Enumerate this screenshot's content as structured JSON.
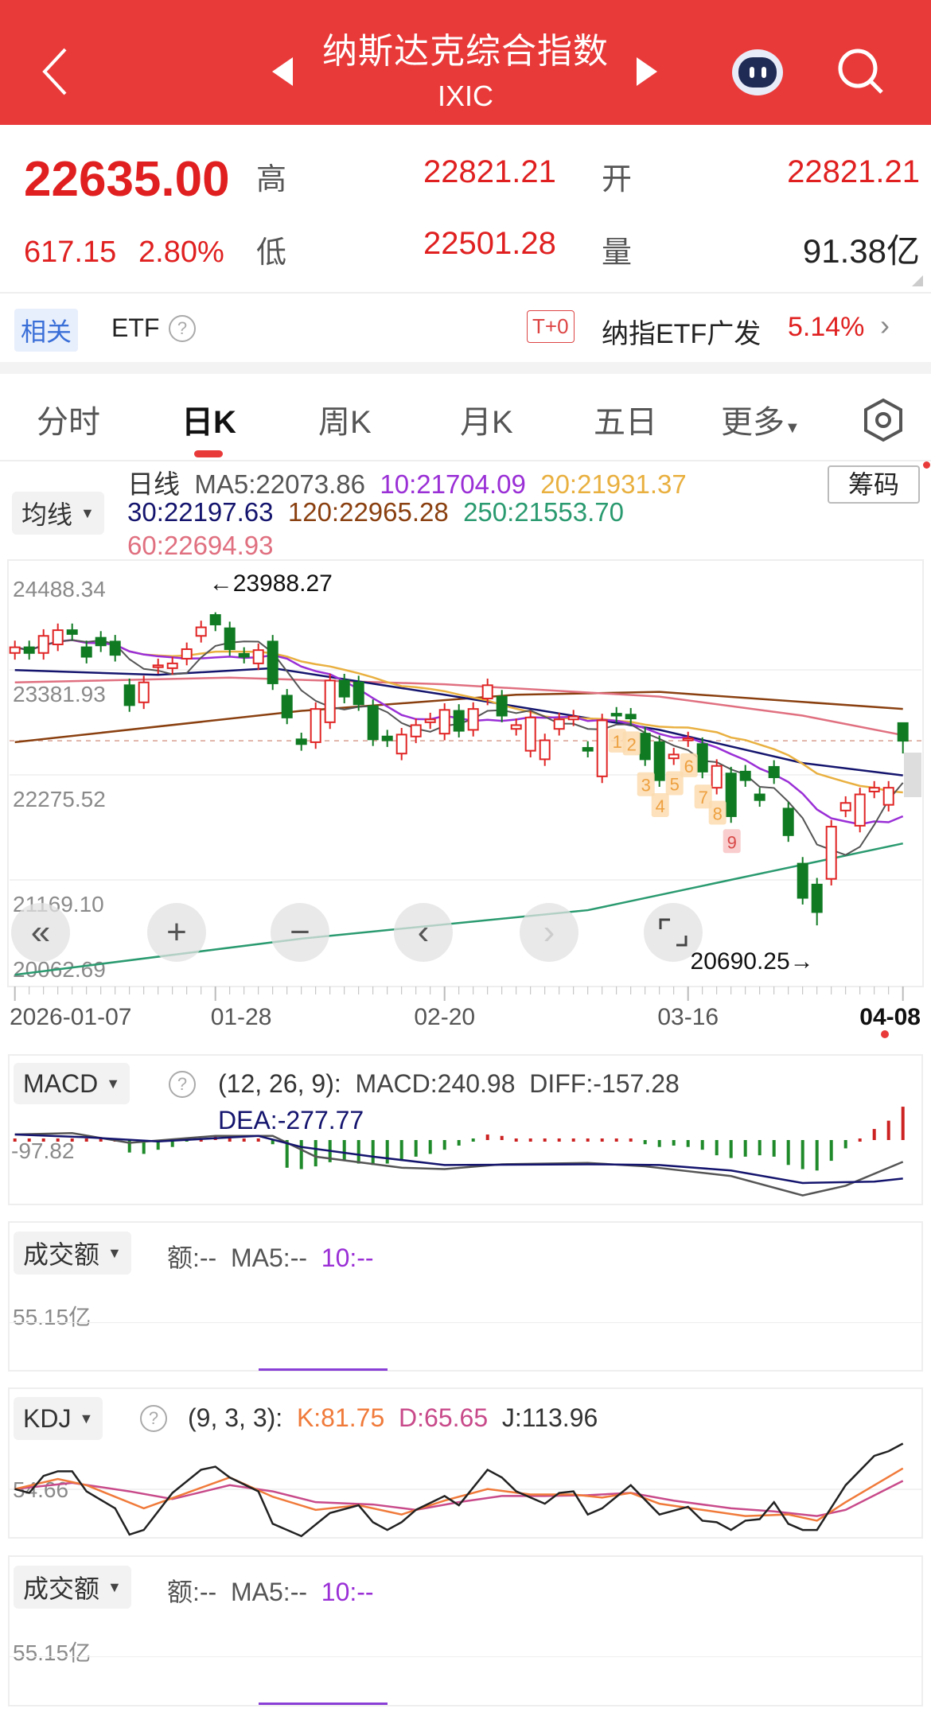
{
  "header": {
    "title": "纳斯达克综合指数",
    "code": "IXIC",
    "back_icon": "chevron-left-icon",
    "prev_icon": "triangle-left-icon",
    "next_icon": "triangle-right-icon",
    "robot_icon": "robot-assistant-icon",
    "search_icon": "search-icon"
  },
  "quote": {
    "price": "22635.00",
    "change": "617.15",
    "change_pct": "2.80%",
    "high_label": "高",
    "high": "22821.21",
    "open_label": "开",
    "open": "22821.21",
    "low_label": "低",
    "low": "22501.28",
    "volume_label": "量",
    "volume": "91.38亿"
  },
  "etf": {
    "tag": "相关",
    "label": "ETF",
    "badge": "T+0",
    "name": "纳指ETF广发",
    "pct": "5.14%"
  },
  "tabs": [
    {
      "label": "分时"
    },
    {
      "label": "日K",
      "active": true
    },
    {
      "label": "周K"
    },
    {
      "label": "月K"
    },
    {
      "label": "五日"
    },
    {
      "label": "更多"
    }
  ],
  "ma_selector": "均线",
  "chips_button": "筹码",
  "ma_legend": {
    "title": "日线",
    "ma5": "MA5:22073.86",
    "ma10": "10:21704.09",
    "ma20": "20:21931.37",
    "ma30": "30:22197.63",
    "ma120": "120:22965.28",
    "ma250": "250:21553.70",
    "ma60": "60:22694.93"
  },
  "colors": {
    "up": "#e02424",
    "down": "#0f7a22",
    "ma5": "#555555",
    "ma10": "#9a2fd6",
    "ma20": "#e9b040",
    "ma30": "#14146e",
    "ma60": "#e07080",
    "ma120": "#8a4010",
    "ma250": "#2a9a70"
  },
  "chart_data": {
    "type": "candlestick",
    "y_ticks": [
      "24488.34",
      "23381.93",
      "22275.52",
      "21169.10",
      "20062.69"
    ],
    "ylim": [
      20062.69,
      24488.34
    ],
    "x_labels": [
      "2026-01-07",
      "01-28",
      "02-20",
      "03-16",
      "04-08"
    ],
    "x_label_index": [
      0,
      14,
      30,
      47,
      62
    ],
    "high_marker": {
      "text": "←23988.27",
      "index": 14,
      "value": 23988.27
    },
    "low_marker": {
      "text": "20690.25→",
      "index": 56,
      "value": 20690.25
    },
    "last_price": 22635,
    "candles_oc": [
      [
        23560,
        23620
      ],
      [
        23620,
        23560
      ],
      [
        23560,
        23740
      ],
      [
        23650,
        23800
      ],
      [
        23800,
        23760
      ],
      [
        23620,
        23520
      ],
      [
        23720,
        23640
      ],
      [
        23680,
        23540
      ],
      [
        23220,
        23010
      ],
      [
        23040,
        23250
      ],
      [
        23410,
        23430
      ],
      [
        23400,
        23450
      ],
      [
        23500,
        23600
      ],
      [
        23740,
        23830
      ],
      [
        23960,
        23860
      ],
      [
        23820,
        23600
      ],
      [
        23550,
        23520
      ],
      [
        23450,
        23590
      ],
      [
        23680,
        23240
      ],
      [
        23110,
        22880
      ],
      [
        22650,
        22600
      ],
      [
        22620,
        22970
      ],
      [
        22830,
        23270
      ],
      [
        23270,
        23100
      ],
      [
        23250,
        23020
      ],
      [
        23000,
        22650
      ],
      [
        22680,
        22640
      ],
      [
        22500,
        22700
      ],
      [
        22680,
        22800
      ],
      [
        22830,
        22860
      ],
      [
        22710,
        22960
      ],
      [
        22950,
        22740
      ],
      [
        22750,
        22970
      ],
      [
        23080,
        23220
      ],
      [
        23100,
        22900
      ],
      [
        22760,
        22800
      ],
      [
        22530,
        22880
      ],
      [
        22440,
        22640
      ],
      [
        22760,
        22860
      ],
      [
        22860,
        22890
      ],
      [
        22560,
        22530
      ],
      [
        22260,
        22850
      ],
      [
        22920,
        22900
      ],
      [
        22910,
        22870
      ],
      [
        22710,
        22440
      ],
      [
        22620,
        22220
      ],
      [
        22450,
        22490
      ],
      [
        22640,
        22660
      ],
      [
        22600,
        22310
      ],
      [
        22140,
        22370
      ],
      [
        22290,
        21840
      ],
      [
        22310,
        22220
      ],
      [
        22070,
        22010
      ],
      [
        22360,
        22250
      ],
      [
        21920,
        21640
      ],
      [
        21340,
        20980
      ],
      [
        21120,
        20830
      ],
      [
        21180,
        21730
      ],
      [
        21900,
        21980
      ],
      [
        21740,
        22070
      ],
      [
        22100,
        22140
      ],
      [
        21960,
        22140
      ],
      [
        22821.21,
        22635
      ]
    ],
    "wick_overrides": {
      "14": [
        23988.27,
        null
      ],
      "56": [
        null,
        20690.25
      ],
      "62": [
        22821.21,
        22501.28
      ]
    },
    "ma30": [
      [
        0,
        23380
      ],
      [
        10,
        23330
      ],
      [
        18,
        23400
      ],
      [
        30,
        23120
      ],
      [
        45,
        22750
      ],
      [
        55,
        22400
      ],
      [
        62,
        22270
      ]
    ],
    "ma60": [
      [
        0,
        23250
      ],
      [
        15,
        23300
      ],
      [
        30,
        23230
      ],
      [
        45,
        23100
      ],
      [
        55,
        22900
      ],
      [
        62,
        22694
      ]
    ],
    "ma120": [
      [
        0,
        22620
      ],
      [
        20,
        22950
      ],
      [
        35,
        23120
      ],
      [
        45,
        23150
      ],
      [
        62,
        22970
      ]
    ],
    "ma250": [
      [
        0,
        20170
      ],
      [
        20,
        20550
      ],
      [
        40,
        20850
      ],
      [
        50,
        21170
      ],
      [
        62,
        21553
      ]
    ],
    "td_labels": [
      {
        "i": 42,
        "t": "1"
      },
      {
        "i": 43,
        "t": "2"
      },
      {
        "i": 44,
        "t": "3"
      },
      {
        "i": 45,
        "t": "4"
      },
      {
        "i": 46,
        "t": "5"
      },
      {
        "i": 47,
        "t": "6"
      },
      {
        "i": 48,
        "t": "7"
      },
      {
        "i": 49,
        "t": "8"
      },
      {
        "i": 50,
        "t": "9",
        "hot": true
      }
    ],
    "macd": {
      "hist": [
        10,
        8,
        12,
        15,
        14,
        10,
        6,
        4,
        -90,
        -100,
        -70,
        -50,
        -20,
        10,
        30,
        25,
        15,
        5,
        -30,
        -200,
        -210,
        -190,
        -160,
        -150,
        -170,
        -180,
        -170,
        -150,
        -120,
        -100,
        -70,
        -40,
        -20,
        40,
        30,
        15,
        10,
        8,
        10,
        10,
        8,
        10,
        15,
        20,
        -30,
        -50,
        -40,
        -50,
        -70,
        -110,
        -130,
        -120,
        -110,
        -120,
        -180,
        -210,
        -220,
        -150,
        -60,
        20,
        80,
        140,
        240.98
      ],
      "diff": [
        [
          0,
          40
        ],
        [
          4,
          50
        ],
        [
          8,
          -20
        ],
        [
          14,
          30
        ],
        [
          18,
          30
        ],
        [
          21,
          -120
        ],
        [
          27,
          -200
        ],
        [
          30,
          -210
        ],
        [
          34,
          -175
        ],
        [
          40,
          -165
        ],
        [
          44,
          -190
        ],
        [
          50,
          -260
        ],
        [
          55,
          -400
        ],
        [
          58,
          -330
        ],
        [
          62,
          -157.28
        ]
      ],
      "dea": [
        [
          0,
          40
        ],
        [
          5,
          20
        ],
        [
          10,
          -10
        ],
        [
          17,
          30
        ],
        [
          20,
          -50
        ],
        [
          25,
          -120
        ],
        [
          30,
          -180
        ],
        [
          40,
          -175
        ],
        [
          45,
          -180
        ],
        [
          50,
          -220
        ],
        [
          55,
          -310
        ],
        [
          60,
          -300
        ],
        [
          62,
          -277.77
        ]
      ]
    },
    "kdj": {
      "k": [
        [
          0,
          55
        ],
        [
          3,
          68
        ],
        [
          5,
          60
        ],
        [
          9,
          30
        ],
        [
          12,
          50
        ],
        [
          15,
          70
        ],
        [
          18,
          45
        ],
        [
          21,
          28
        ],
        [
          24,
          34
        ],
        [
          27,
          22
        ],
        [
          30,
          40
        ],
        [
          33,
          55
        ],
        [
          36,
          48
        ],
        [
          39,
          48
        ],
        [
          41,
          44
        ],
        [
          43,
          50
        ],
        [
          45,
          36
        ],
        [
          48,
          28
        ],
        [
          51,
          20
        ],
        [
          54,
          22
        ],
        [
          56,
          14
        ],
        [
          58,
          38
        ],
        [
          62,
          81.75
        ]
      ],
      "d": [
        [
          0,
          55
        ],
        [
          4,
          63
        ],
        [
          8,
          52
        ],
        [
          11,
          42
        ],
        [
          15,
          60
        ],
        [
          18,
          52
        ],
        [
          21,
          38
        ],
        [
          25,
          35
        ],
        [
          28,
          28
        ],
        [
          31,
          38
        ],
        [
          34,
          46
        ],
        [
          37,
          46
        ],
        [
          40,
          47
        ],
        [
          43,
          50
        ],
        [
          46,
          40
        ],
        [
          50,
          30
        ],
        [
          53,
          26
        ],
        [
          56,
          20
        ],
        [
          58,
          28
        ],
        [
          62,
          65.65
        ]
      ],
      "j": [
        [
          0,
          55
        ],
        [
          1,
          50
        ],
        [
          2,
          72
        ],
        [
          3,
          78
        ],
        [
          4,
          78
        ],
        [
          5,
          52
        ],
        [
          7,
          30
        ],
        [
          8,
          -4
        ],
        [
          9,
          2
        ],
        [
          11,
          50
        ],
        [
          13,
          80
        ],
        [
          14,
          84
        ],
        [
          15,
          70
        ],
        [
          17,
          52
        ],
        [
          18,
          10
        ],
        [
          20,
          -6
        ],
        [
          22,
          24
        ],
        [
          24,
          34
        ],
        [
          25,
          12
        ],
        [
          26,
          2
        ],
        [
          27,
          12
        ],
        [
          28,
          28
        ],
        [
          30,
          46
        ],
        [
          31,
          34
        ],
        [
          33,
          80
        ],
        [
          34,
          70
        ],
        [
          35,
          52
        ],
        [
          37,
          36
        ],
        [
          38,
          50
        ],
        [
          39,
          52
        ],
        [
          40,
          22
        ],
        [
          41,
          30
        ],
        [
          43,
          60
        ],
        [
          45,
          22
        ],
        [
          47,
          32
        ],
        [
          48,
          14
        ],
        [
          49,
          12
        ],
        [
          50,
          2
        ],
        [
          51,
          14
        ],
        [
          52,
          16
        ],
        [
          53,
          38
        ],
        [
          54,
          10
        ],
        [
          55,
          2
        ],
        [
          56,
          2
        ],
        [
          58,
          60
        ],
        [
          60,
          98
        ],
        [
          61,
          104
        ],
        [
          62,
          113.96
        ]
      ]
    }
  },
  "macd_panel": {
    "selector": "MACD",
    "params": "(12, 26, 9):",
    "macd": "MACD:240.98",
    "diff": "DIFF:-157.28",
    "dea": "DEA:-277.77",
    "axis": "-97.82"
  },
  "volume_panel": {
    "selector": "成交额",
    "amount": "额:--",
    "ma5": "MA5:--",
    "ma10": "10:--",
    "axis": "55.15亿"
  },
  "kdj_panel": {
    "selector": "KDJ",
    "params": "(9, 3, 3):",
    "k": "K:81.75",
    "d": "D:65.65",
    "j": "J:113.96",
    "axis": "54.66"
  },
  "volume_panel2": {
    "selector": "成交额",
    "amount": "额:--",
    "ma5": "MA5:--",
    "ma10": "10:--",
    "axis": "55.15亿"
  }
}
